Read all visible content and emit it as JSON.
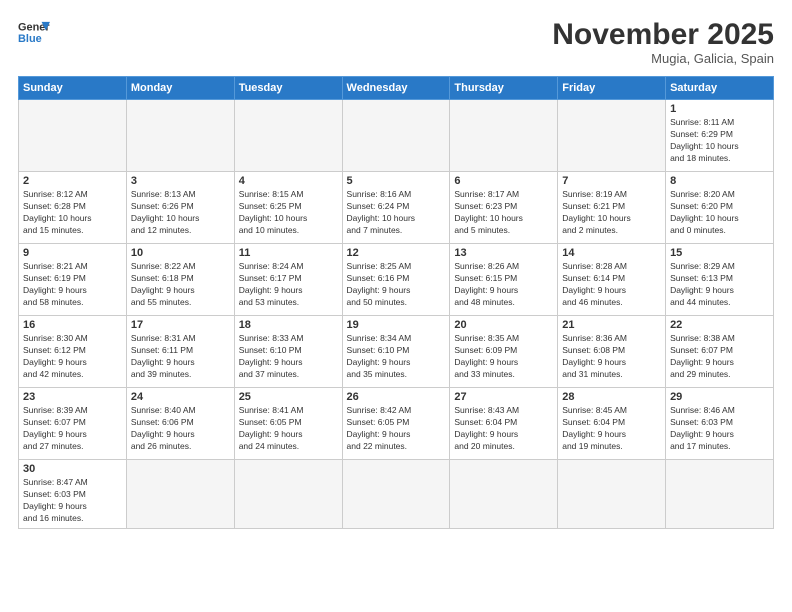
{
  "logo": {
    "line1": "General",
    "line2": "Blue"
  },
  "title": "November 2025",
  "subtitle": "Mugia, Galicia, Spain",
  "headers": [
    "Sunday",
    "Monday",
    "Tuesday",
    "Wednesday",
    "Thursday",
    "Friday",
    "Saturday"
  ],
  "weeks": [
    [
      {
        "day": "",
        "info": ""
      },
      {
        "day": "",
        "info": ""
      },
      {
        "day": "",
        "info": ""
      },
      {
        "day": "",
        "info": ""
      },
      {
        "day": "",
        "info": ""
      },
      {
        "day": "",
        "info": ""
      },
      {
        "day": "1",
        "info": "Sunrise: 8:11 AM\nSunset: 6:29 PM\nDaylight: 10 hours\nand 18 minutes."
      }
    ],
    [
      {
        "day": "2",
        "info": "Sunrise: 8:12 AM\nSunset: 6:28 PM\nDaylight: 10 hours\nand 15 minutes."
      },
      {
        "day": "3",
        "info": "Sunrise: 8:13 AM\nSunset: 6:26 PM\nDaylight: 10 hours\nand 12 minutes."
      },
      {
        "day": "4",
        "info": "Sunrise: 8:15 AM\nSunset: 6:25 PM\nDaylight: 10 hours\nand 10 minutes."
      },
      {
        "day": "5",
        "info": "Sunrise: 8:16 AM\nSunset: 6:24 PM\nDaylight: 10 hours\nand 7 minutes."
      },
      {
        "day": "6",
        "info": "Sunrise: 8:17 AM\nSunset: 6:23 PM\nDaylight: 10 hours\nand 5 minutes."
      },
      {
        "day": "7",
        "info": "Sunrise: 8:19 AM\nSunset: 6:21 PM\nDaylight: 10 hours\nand 2 minutes."
      },
      {
        "day": "8",
        "info": "Sunrise: 8:20 AM\nSunset: 6:20 PM\nDaylight: 10 hours\nand 0 minutes."
      }
    ],
    [
      {
        "day": "9",
        "info": "Sunrise: 8:21 AM\nSunset: 6:19 PM\nDaylight: 9 hours\nand 58 minutes."
      },
      {
        "day": "10",
        "info": "Sunrise: 8:22 AM\nSunset: 6:18 PM\nDaylight: 9 hours\nand 55 minutes."
      },
      {
        "day": "11",
        "info": "Sunrise: 8:24 AM\nSunset: 6:17 PM\nDaylight: 9 hours\nand 53 minutes."
      },
      {
        "day": "12",
        "info": "Sunrise: 8:25 AM\nSunset: 6:16 PM\nDaylight: 9 hours\nand 50 minutes."
      },
      {
        "day": "13",
        "info": "Sunrise: 8:26 AM\nSunset: 6:15 PM\nDaylight: 9 hours\nand 48 minutes."
      },
      {
        "day": "14",
        "info": "Sunrise: 8:28 AM\nSunset: 6:14 PM\nDaylight: 9 hours\nand 46 minutes."
      },
      {
        "day": "15",
        "info": "Sunrise: 8:29 AM\nSunset: 6:13 PM\nDaylight: 9 hours\nand 44 minutes."
      }
    ],
    [
      {
        "day": "16",
        "info": "Sunrise: 8:30 AM\nSunset: 6:12 PM\nDaylight: 9 hours\nand 42 minutes."
      },
      {
        "day": "17",
        "info": "Sunrise: 8:31 AM\nSunset: 6:11 PM\nDaylight: 9 hours\nand 39 minutes."
      },
      {
        "day": "18",
        "info": "Sunrise: 8:33 AM\nSunset: 6:10 PM\nDaylight: 9 hours\nand 37 minutes."
      },
      {
        "day": "19",
        "info": "Sunrise: 8:34 AM\nSunset: 6:10 PM\nDaylight: 9 hours\nand 35 minutes."
      },
      {
        "day": "20",
        "info": "Sunrise: 8:35 AM\nSunset: 6:09 PM\nDaylight: 9 hours\nand 33 minutes."
      },
      {
        "day": "21",
        "info": "Sunrise: 8:36 AM\nSunset: 6:08 PM\nDaylight: 9 hours\nand 31 minutes."
      },
      {
        "day": "22",
        "info": "Sunrise: 8:38 AM\nSunset: 6:07 PM\nDaylight: 9 hours\nand 29 minutes."
      }
    ],
    [
      {
        "day": "23",
        "info": "Sunrise: 8:39 AM\nSunset: 6:07 PM\nDaylight: 9 hours\nand 27 minutes."
      },
      {
        "day": "24",
        "info": "Sunrise: 8:40 AM\nSunset: 6:06 PM\nDaylight: 9 hours\nand 26 minutes."
      },
      {
        "day": "25",
        "info": "Sunrise: 8:41 AM\nSunset: 6:05 PM\nDaylight: 9 hours\nand 24 minutes."
      },
      {
        "day": "26",
        "info": "Sunrise: 8:42 AM\nSunset: 6:05 PM\nDaylight: 9 hours\nand 22 minutes."
      },
      {
        "day": "27",
        "info": "Sunrise: 8:43 AM\nSunset: 6:04 PM\nDaylight: 9 hours\nand 20 minutes."
      },
      {
        "day": "28",
        "info": "Sunrise: 8:45 AM\nSunset: 6:04 PM\nDaylight: 9 hours\nand 19 minutes."
      },
      {
        "day": "29",
        "info": "Sunrise: 8:46 AM\nSunset: 6:03 PM\nDaylight: 9 hours\nand 17 minutes."
      }
    ],
    [
      {
        "day": "30",
        "info": "Sunrise: 8:47 AM\nSunset: 6:03 PM\nDaylight: 9 hours\nand 16 minutes."
      },
      {
        "day": "",
        "info": ""
      },
      {
        "day": "",
        "info": ""
      },
      {
        "day": "",
        "info": ""
      },
      {
        "day": "",
        "info": ""
      },
      {
        "day": "",
        "info": ""
      },
      {
        "day": "",
        "info": ""
      }
    ]
  ]
}
